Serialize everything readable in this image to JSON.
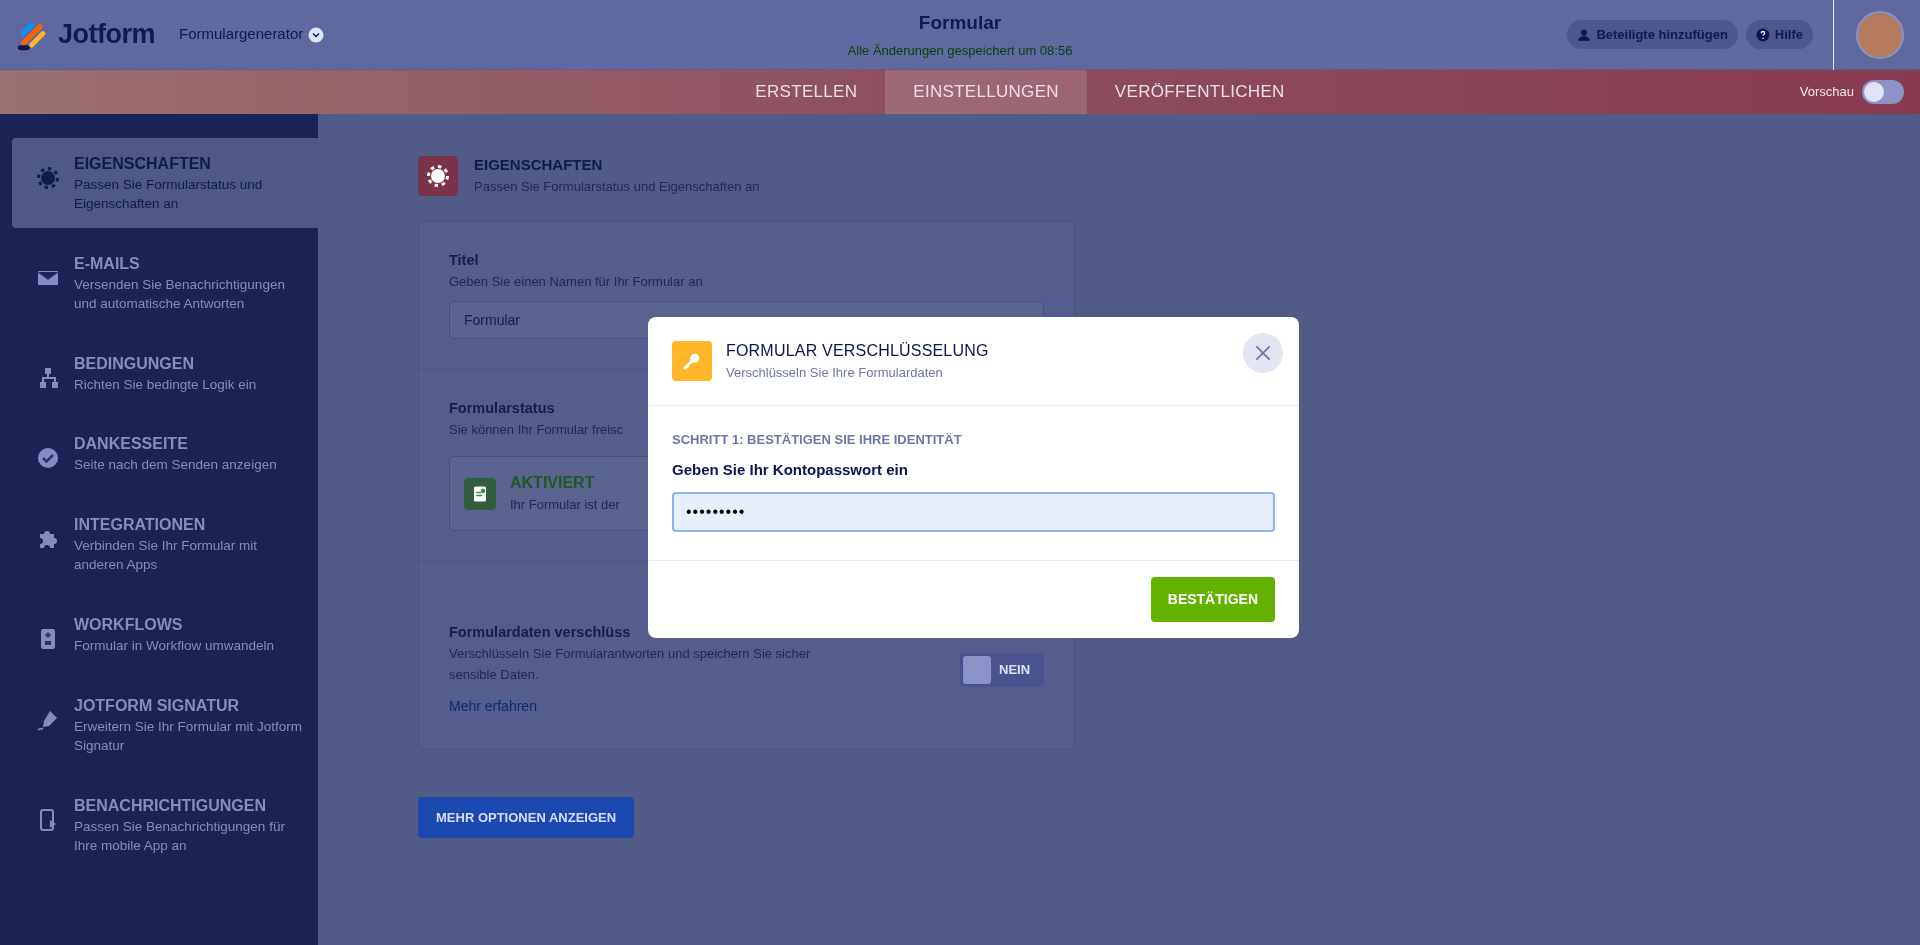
{
  "header": {
    "logo": "Jotform",
    "builder_menu": "Formulargenerator",
    "title": "Formular",
    "save_status": "Alle Änderungen gespeichert um 08:56",
    "buttons": [
      {
        "kind": "user",
        "label": "Beteiligte hinzufügen"
      },
      {
        "kind": "help",
        "label": "Hilfe"
      }
    ]
  },
  "tabs": [
    {
      "label": "ERSTELLEN",
      "selected": false
    },
    {
      "label": "EINSTELLUNGEN",
      "selected": true
    },
    {
      "label": "VERÖFFENTLICHEN",
      "selected": false
    }
  ],
  "preview": {
    "label": "Vorschau",
    "on": false
  },
  "sidebar": {
    "items": [
      {
        "kind": "gear",
        "title": "EIGENSCHAFTEN",
        "description": "Passen Sie Formularstatus und Eigenschaften an",
        "selected": true
      },
      {
        "kind": "mail",
        "title": "E-MAILS",
        "description": "Versenden Sie Benachrichtigungen und automatische Antworten",
        "selected": false
      },
      {
        "kind": "sitemap",
        "title": "BEDINGUNGEN",
        "description": "Richten Sie bedingte Logik ein",
        "selected": false
      },
      {
        "kind": "check",
        "title": "DANKESSEITE",
        "description": "Seite nach dem Senden anzeigen",
        "selected": false
      },
      {
        "kind": "puzzle",
        "title": "INTEGRATIONEN",
        "description": "Verbinden Sie Ihr Formular mit anderen Apps",
        "selected": false
      },
      {
        "kind": "workflow",
        "title": "WORKFLOWS",
        "description": "Formular in Workflow umwandeln",
        "selected": false
      },
      {
        "kind": "pen",
        "title": "JOTFORM SIGNATUR",
        "description": "Erweitern Sie Ihr Formular mit Jotform Signatur",
        "selected": false
      },
      {
        "kind": "phone",
        "title": "BENACHRICHTIGUNGEN",
        "description": "Passen Sie Benachrichtigungen für Ihre mobile App an",
        "selected": false
      }
    ]
  },
  "page": {
    "title": "EIGENSCHAFTEN",
    "subtitle": "Passen Sie Formularstatus und Eigenschaften an"
  },
  "sections": [
    {
      "kind": "text_field",
      "title": "Titel",
      "description": "Geben Sie einen Namen für Ihr Formular an",
      "value": "Formular"
    },
    {
      "kind": "status",
      "title": "Formularstatus",
      "description": "Sie können Ihr Formular freisc",
      "status": "AKTIVIERT",
      "status_text": "Ihr Formular ist der"
    },
    {
      "kind": "toggle",
      "title": "Formulardaten verschlüss",
      "description": "Verschlüsseln Sie Formularantworten und speichern Sie sicher sensible Daten.",
      "link": "Mehr erfahren",
      "toggle": {
        "label": "NEIN",
        "on": false
      }
    }
  ],
  "more_button": "MEHR OPTIONEN ANZEIGEN",
  "modal": {
    "title": "FORMULAR VERSCHLÜSSELUNG",
    "subtitle": "Verschlüsseln Sie Ihre Formulardaten",
    "step": "SCHRITT 1: BESTÄTIGEN SIE IHRE IDENTITÄT",
    "field_label": "Geben Sie Ihr Kontopasswort ein",
    "password": "•••••••••",
    "confirm": "BESTÄTIGEN"
  }
}
